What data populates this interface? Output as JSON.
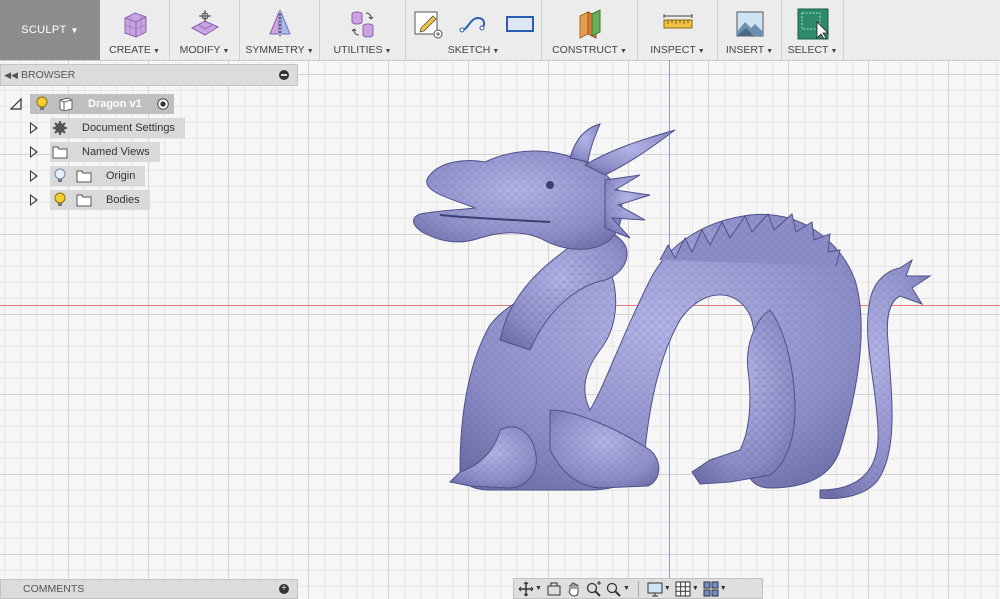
{
  "toolbar": {
    "workspace": "SCULPT",
    "groups": [
      {
        "label": "CREATE",
        "icon": "create-box-icon"
      },
      {
        "label": "MODIFY",
        "icon": "modify-icon"
      },
      {
        "label": "SYMMETRY",
        "icon": "symmetry-icon"
      },
      {
        "label": "UTILITIES",
        "icon": "utilities-icon"
      },
      {
        "label": "SKETCH",
        "icon": "sketch-icon"
      },
      {
        "label": "CONSTRUCT",
        "icon": "construct-plane-icon"
      },
      {
        "label": "INSPECT",
        "icon": "measure-icon"
      },
      {
        "label": "INSERT",
        "icon": "insert-image-icon"
      },
      {
        "label": "SELECT",
        "icon": "select-icon"
      }
    ]
  },
  "browser": {
    "title": "BROWSER",
    "root": "Dragon v1",
    "items": [
      {
        "label": "Document Settings",
        "icon": "gear-icon"
      },
      {
        "label": "Named Views",
        "icon": "folder-icon"
      },
      {
        "label": "Origin",
        "icon": "folder-icon",
        "visibility": "off"
      },
      {
        "label": "Bodies",
        "icon": "folder-icon",
        "visibility": "on"
      }
    ]
  },
  "comments": {
    "title": "COMMENTS"
  },
  "navbar": {
    "items": [
      "orbit-icon",
      "look-at-icon",
      "pan-icon",
      "zoom-icon",
      "zoom-window-icon",
      "display-settings-icon",
      "grid-icon",
      "viewports-icon"
    ]
  },
  "colors": {
    "toolbar_bg": "#ececec",
    "workspace_bg": "#8d8d8d",
    "canvas_bg": "#f6f6f6",
    "dragon": "#8d8ec8",
    "axis_red": "#e06a6a",
    "axis_blue": "#7f8fe0",
    "bulb_on": "#f2cf2f"
  }
}
